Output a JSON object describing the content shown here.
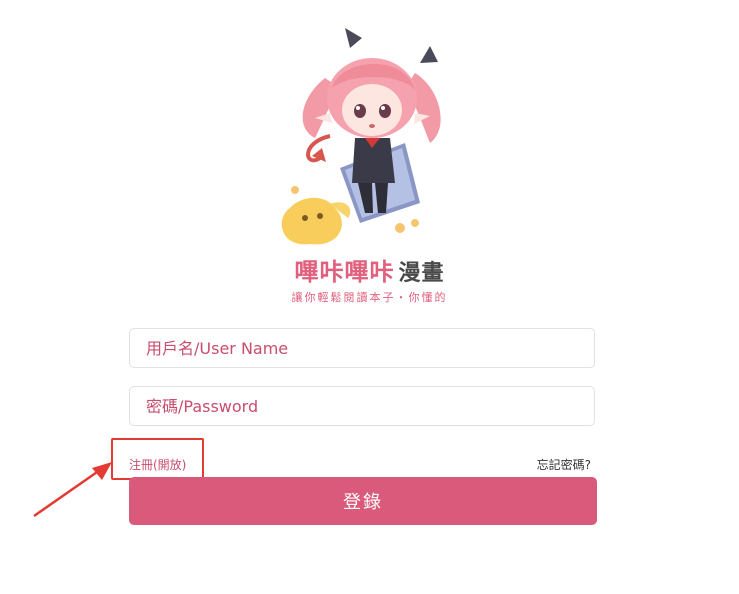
{
  "logo": {
    "title_pink": "嗶咔嗶咔",
    "title_dark": "漫畫",
    "tagline": "讓你輕鬆閱讀本子・你懂的"
  },
  "form": {
    "username_placeholder": "用戶名/User Name",
    "password_placeholder": "密碼/Password",
    "register_label": "注冊(開放)",
    "forgot_label": "忘記密碼?",
    "login_label": "登錄"
  },
  "colors": {
    "accent": "#da5a7b",
    "annotation": "#e33a32"
  }
}
